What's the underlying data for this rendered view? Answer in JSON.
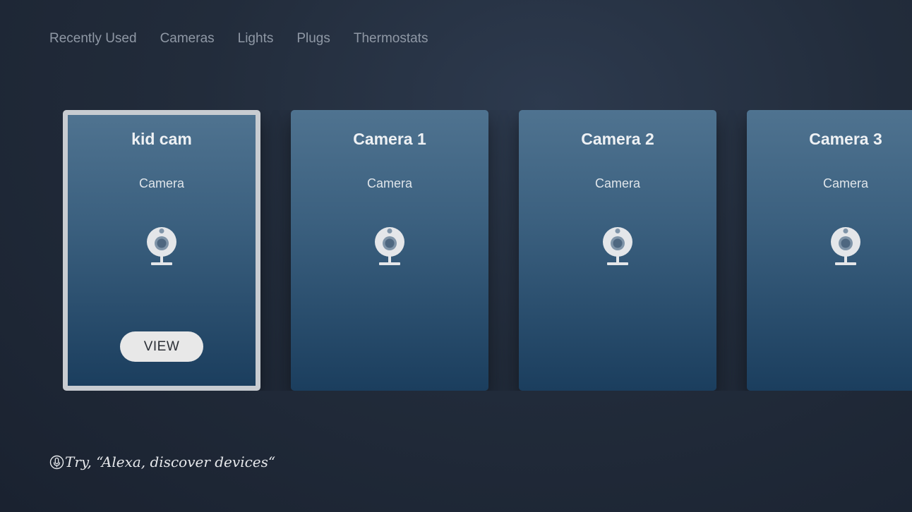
{
  "nav": {
    "items": [
      {
        "label": "Recently Used"
      },
      {
        "label": "Cameras"
      },
      {
        "label": "Lights"
      },
      {
        "label": "Plugs"
      },
      {
        "label": "Thermostats"
      }
    ]
  },
  "cards": [
    {
      "title": "kid cam",
      "subtitle": "Camera",
      "icon": "webcam-icon",
      "action_label": "VIEW",
      "focused": true
    },
    {
      "title": "Camera 1",
      "subtitle": "Camera",
      "icon": "webcam-icon"
    },
    {
      "title": "Camera 2",
      "subtitle": "Camera",
      "icon": "webcam-icon"
    },
    {
      "title": "Camera 3",
      "subtitle": "Camera",
      "icon": "webcam-icon"
    }
  ],
  "hint": {
    "icon": "microphone-icon",
    "text": "Try, “Alexa, discover devices“"
  },
  "colors": {
    "background": "#222c3b",
    "card_top": "#4f7390",
    "card_bottom": "#1b3e5e",
    "focus_border": "#c8ccd1",
    "nav_text": "#8f98a5"
  }
}
